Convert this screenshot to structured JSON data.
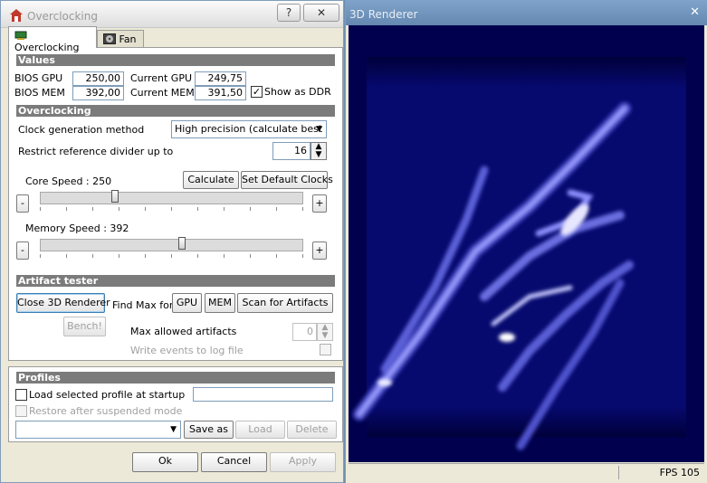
{
  "main_window": {
    "title": "Overclocking",
    "help_label": "?",
    "close_label": "✕",
    "tabs": [
      {
        "label": "Overclocking"
      },
      {
        "label": "Fan"
      }
    ]
  },
  "values_section": {
    "header": "Values",
    "bios_gpu_label": "BIOS GPU",
    "bios_gpu_value": "250,00",
    "current_gpu_label": "Current GPU",
    "current_gpu_value": "249,75",
    "bios_mem_label": "BIOS MEM",
    "bios_mem_value": "392,00",
    "current_mem_label": "Current MEM",
    "current_mem_value": "391,50",
    "show_ddr_label": "Show as DDR",
    "show_ddr_checked": true
  },
  "overclocking_section": {
    "header": "Overclocking",
    "clock_method_label": "Clock generation method",
    "clock_method_value": "High precision (calculate best di",
    "restrict_label": "Restrict reference divider up to",
    "restrict_value": "16",
    "core_speed_label": "Core Speed : 250",
    "core_slider_fraction": 0.28,
    "calculate_button": "Calculate",
    "default_clocks_button": "Set Default Clocks",
    "memory_speed_label": "Memory Speed : 392",
    "memory_slider_fraction": 0.54,
    "minus_label": "-",
    "plus_label": "+"
  },
  "artifact_section": {
    "header": "Artifact tester",
    "close_renderer_button": "Close 3D Renderer",
    "find_max_label": "Find Max for",
    "gpu_button": "GPU",
    "mem_button": "MEM",
    "scan_button": "Scan for Artifacts",
    "bench_button": "Bench!",
    "max_artifacts_label": "Max allowed artifacts",
    "max_artifacts_value": "0",
    "write_events_label": "Write events to log file"
  },
  "profiles_section": {
    "header": "Profiles",
    "load_profile_label": "Load selected profile at startup",
    "restore_label": "Restore after suspended mode",
    "save_as_button": "Save as",
    "load_button": "Load",
    "delete_button": "Delete"
  },
  "footer": {
    "ok_button": "Ok",
    "cancel_button": "Cancel",
    "apply_button": "Apply"
  },
  "renderer_window": {
    "title": "3D Renderer",
    "close_label": "✕",
    "fps_label": "FPS 105"
  },
  "colors": {
    "renderer_background": "#000068",
    "render_glow": "#9a9cff",
    "section_header": "#7b7b7b"
  }
}
